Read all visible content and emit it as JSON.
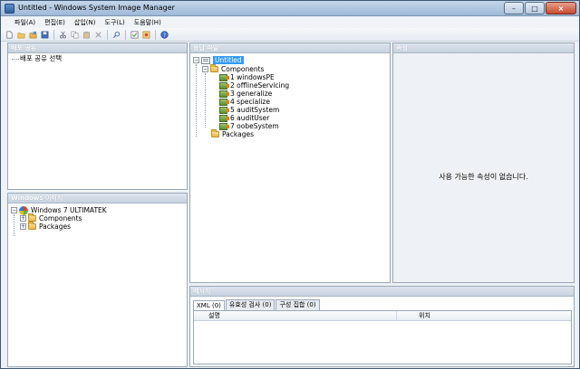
{
  "window": {
    "title": "Untitled - Windows System Image Manager",
    "controls": {
      "minimize": "–",
      "maximize": "□",
      "close": "×"
    }
  },
  "menu": [
    "파일(A)",
    "편집(E)",
    "삽입(N)",
    "도구(L)",
    "도움말(H)"
  ],
  "toolbar": {
    "icons": [
      "new-icon",
      "open-icon",
      "open-dist-icon",
      "save-icon",
      "cut-icon",
      "copy-icon",
      "paste-icon",
      "delete-icon",
      "find-icon",
      "validate-icon",
      "create-config-icon",
      "help-icon"
    ]
  },
  "panels": {
    "distribution": {
      "title": "배포 공유",
      "items": [
        {
          "label": "배포 공유 선택"
        }
      ]
    },
    "windows_image": {
      "title": "Windows 이미지",
      "root": "Windows 7 ULTIMATEK",
      "children": [
        "Components",
        "Packages"
      ]
    },
    "answer_file": {
      "title": "응답 파일",
      "root": "Untitled",
      "components_label": "Components",
      "passes": [
        "1 windowsPE",
        "2 offlineServicing",
        "3 generalize",
        "4 specialize",
        "5 auditSystem",
        "6 auditUser",
        "7 oobeSystem"
      ],
      "packages_label": "Packages"
    },
    "properties": {
      "title": "속성",
      "empty_message": "사용 가능한 속성이 없습니다."
    },
    "messages": {
      "title": "메시지",
      "tabs": [
        "XML (0)",
        "유효성 검사 (0)",
        "구성 집합 (0)"
      ],
      "active_tab": 0,
      "columns": [
        "설명",
        "위치"
      ]
    }
  }
}
